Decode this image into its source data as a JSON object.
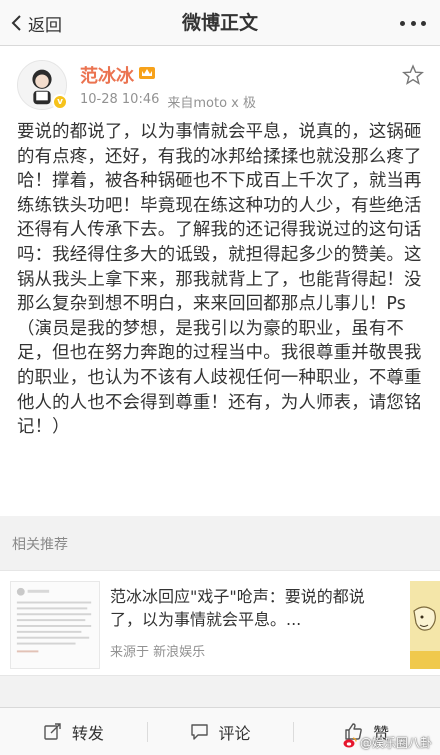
{
  "navbar": {
    "back_label": "返回",
    "title": "微博正文"
  },
  "post": {
    "author": "范冰冰",
    "time": "10-28 10:46",
    "source": "来自moto x 极",
    "text": "要说的都说了，以为事情就会平息，说真的，这锅砸的有点疼，还好，有我的冰邦给揉揉也就没那么疼了哈！撑着，被各种锅砸也不下成百上千次了，就当再练练铁头功吧！毕竟现在练这种功的人少，有些绝活还得有人传承下去。了解我的还记得我说过的这句话吗：我经得住多大的诋毁，就担得起多少的赞美。这锅从我头上拿下来，那我就背上了，也能背得起！没那么复杂到想不明白，来来回回都那点儿事儿！Ps（演员是我的梦想，是我引以为豪的职业，虽有不足，但也在努力奔跑的过程当中。我很尊重并敬畏我的职业，也认为不该有人歧视任何一种职业，不尊重他人的人也不会得到尊重！还有，为人师表，请您铭记！）"
  },
  "related": {
    "header": "相关推荐",
    "items": [
      {
        "title": "范冰冰回应\"戏子\"呛声：要说的都说了，以为事情就会平息。...",
        "source": "来源于 新浪娱乐"
      }
    ]
  },
  "toolbar": {
    "repost_label": "转发",
    "comment_label": "评论",
    "like_label": "赞"
  },
  "watermark": "@娱乐圈八卦",
  "colors": {
    "accent": "#eb7350",
    "text": "#333333",
    "muted": "#929292",
    "background": "#f2f2f2"
  }
}
